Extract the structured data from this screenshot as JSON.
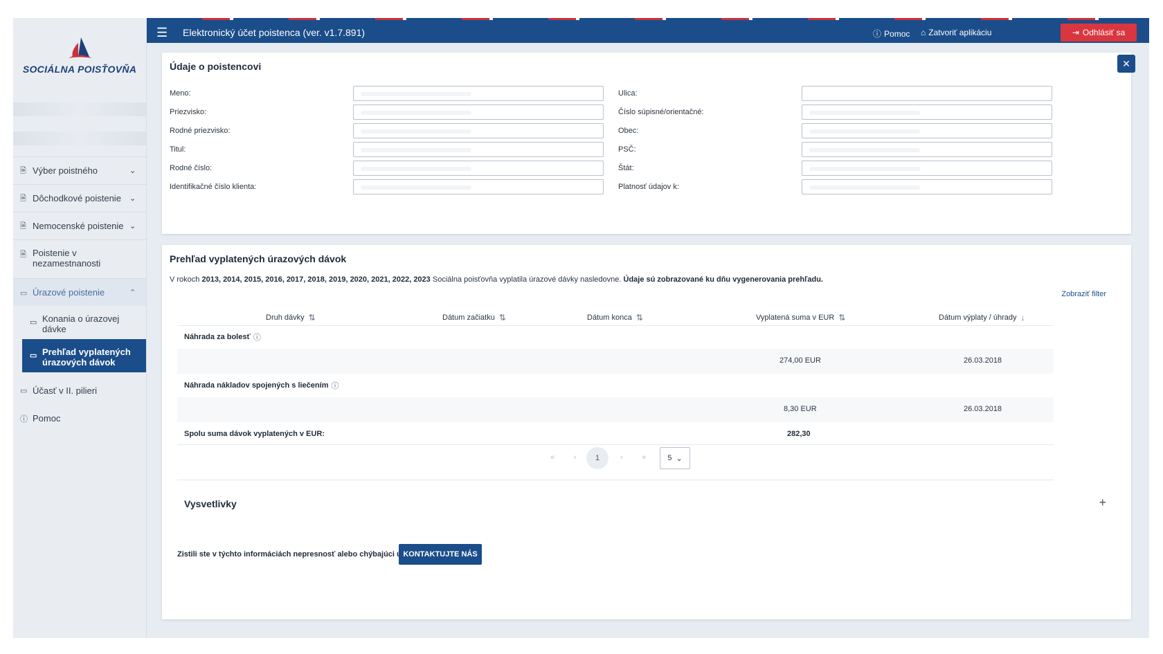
{
  "brand": {
    "name": "SOCIÁLNA POISŤOVŇA"
  },
  "header": {
    "title": "Elektronický účet poistenca (ver. v1.7.891)",
    "help": "Pomoc",
    "close_app": "Zatvoriť aplikáciu",
    "logout": "Odhlásiť sa"
  },
  "sidebar": {
    "items": [
      {
        "label": "Výber poistného",
        "icon": "document-icon",
        "chevron": "⌄"
      },
      {
        "label": "Dôchodkové poistenie",
        "icon": "document-icon",
        "chevron": "⌄"
      },
      {
        "label": "Nemocenské poistenie",
        "icon": "document-icon",
        "chevron": "⌄"
      },
      {
        "label": "Poistenie v nezamestnanosti",
        "icon": "document-icon"
      },
      {
        "label": "Úrazové poistenie",
        "icon": "folder-icon",
        "chevron": "⌃"
      },
      {
        "label": "Účasť v II. pilieri",
        "icon": "wallet-icon"
      },
      {
        "label": "Pomoc",
        "icon": "help-icon"
      }
    ],
    "sub_items": [
      {
        "label": "Konania o úrazovej dávke",
        "icon": "folder-icon"
      },
      {
        "label": "Prehľad vyplatených úrazových dávok",
        "icon": "wallet-icon"
      }
    ]
  },
  "insured": {
    "title": "Údaje o poistencovi",
    "left_fields": [
      "Meno:",
      "Priezvisko:",
      "Rodné priezvisko:",
      "Titul:",
      "Rodné číslo:",
      "Identifikačné číslo klienta:"
    ],
    "right_fields": [
      "Ulica:",
      "Číslo súpisné/orientačné:",
      "Obec:",
      "PSČ:",
      "Štát:",
      "Platnosť údajov k:"
    ]
  },
  "overview": {
    "title": "Prehľad vyplatených úrazových dávok",
    "intro_prefix": "V rokoch",
    "intro_years": "2013, 2014, 2015, 2016, 2017, 2018, 2019, 2020, 2021, 2022, 2023",
    "intro_mid": "Sociálna poisťovňa vyplatila úrazové dávky nasledovne.",
    "intro_bold": "Údaje sú zobrazované ku dňu vygenerovania prehľadu.",
    "filter": "Zobraziť filter",
    "columns": [
      "Druh dávky",
      "Dátum začiatku",
      "Dátum konca",
      "Vyplatená suma v EUR",
      "Dátum výplaty / úhrady"
    ],
    "groups": [
      {
        "name": "Náhrada za bolesť",
        "amount": "274,00 EUR",
        "date": "26.03.2018"
      },
      {
        "name": "Náhrada nákladov spojených s liečením",
        "amount": "8,30 EUR",
        "date": "26.03.2018"
      }
    ],
    "total_label": "Spolu suma dávok vyplatených v EUR:",
    "total_value": "282,30",
    "pager": {
      "first": "«",
      "prev": "‹",
      "page": "1",
      "next": "›",
      "last": "»",
      "page_size": "5"
    },
    "explanations": "Vysvetlivky",
    "contact_question": "Zistili ste v týchto informáciách nepresnosť alebo chýbajúci údaj?",
    "contact_button": "KONTAKTUJTE NÁS"
  },
  "colors": {
    "primary": "#1b4d8a",
    "danger": "#d9363f",
    "background": "#e7ecf2"
  }
}
